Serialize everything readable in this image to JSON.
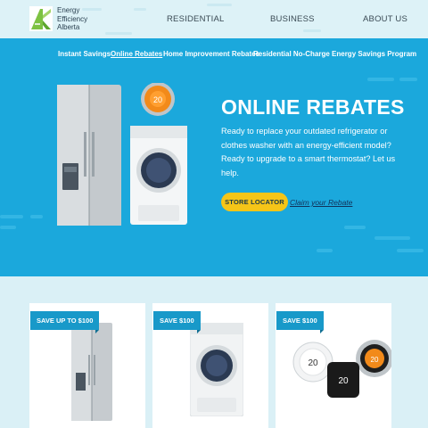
{
  "brand": {
    "name_lines": [
      "Energy",
      "Efficiency",
      "Alberta"
    ]
  },
  "nav": {
    "items": [
      {
        "label": "RESIDENTIAL"
      },
      {
        "label": "BUSINESS"
      },
      {
        "label": "ABOUT US"
      }
    ]
  },
  "subnav": {
    "items": [
      {
        "label": "Instant Savings",
        "active": false
      },
      {
        "label": "Online Rebates",
        "active": true
      },
      {
        "label": "Home Improvement Rebates",
        "active": false
      },
      {
        "label": "Residential No-Charge Energy Savings Program",
        "active": false
      }
    ]
  },
  "hero": {
    "title": "ONLINE REBATES",
    "description": "Ready to replace your outdated refrigerator or clothes washer with an energy-efficient model? Ready to upgrade to a smart thermostat? Let us help.",
    "store_button": "STORE LOCATOR",
    "claim_link": "Claim your Rebate",
    "thermostat_reading": "20"
  },
  "cards": [
    {
      "badge": "SAVE UP TO $100",
      "product_icon": "refrigerator-icon"
    },
    {
      "badge": "SAVE $100",
      "product_icon": "washer-icon"
    },
    {
      "badge": "SAVE $100",
      "product_icon": "thermostats-icon",
      "thermostat_readings": [
        "20",
        "20",
        "20"
      ]
    }
  ],
  "colors": {
    "hero_blue": "#1ba8dc",
    "accent_yellow": "#f5c518",
    "badge_blue": "#1899c9",
    "logo_green": "#7dc242"
  }
}
